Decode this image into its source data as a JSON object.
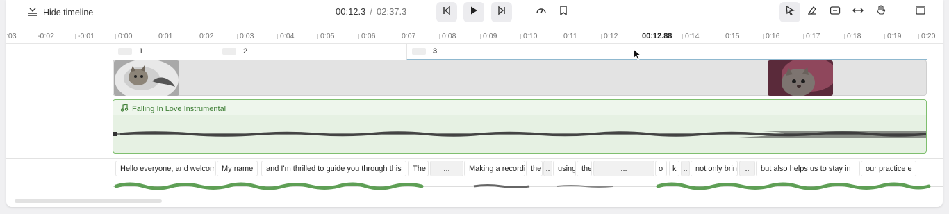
{
  "toolbar": {
    "hide_timeline_label": "Hide timeline",
    "current_time": "00:12.3",
    "separator": "/",
    "total_time": "02:37.3",
    "buttons": [
      "skip-back-icon",
      "play-icon",
      "skip-forward-icon",
      "speed-icon",
      "bookmark-icon",
      "select-tool-icon",
      "eraser-icon",
      "transition-icon",
      "stretch-icon",
      "hand-tool-icon",
      "layout-icon"
    ]
  },
  "ruler": {
    "ticks": [
      ":03",
      "-0:02",
      "-0:01",
      "0:00",
      "0:01",
      "0:02",
      "0:03",
      "0:04",
      "0:05",
      "0:06",
      "0:07",
      "0:08",
      "0:09",
      "0:10",
      "0:11",
      "0:12",
      "0:14",
      "0:15",
      "0:16",
      "0:17",
      "0:18",
      "0:19",
      "0:20"
    ],
    "playhead_label": "00:12.88"
  },
  "scenes": [
    "1",
    "2",
    "3"
  ],
  "audio": {
    "title": "Falling In Love Instrumental",
    "color": "#7fbf6f"
  },
  "captions": [
    "Hello everyone, and welcome",
    "My name",
    "and I'm thrilled to guide you through this",
    "The",
    "...",
    "Making a recording",
    "the",
    "..",
    "using",
    "the",
    "...",
    "o",
    "k",
    "..",
    "not only brings",
    "..",
    "but also helps us to stay in",
    "our practice e"
  ],
  "colors": {
    "playhead": "#4a6fd6",
    "cursor_line": "#888888",
    "wave_green": "#5e9f55"
  }
}
